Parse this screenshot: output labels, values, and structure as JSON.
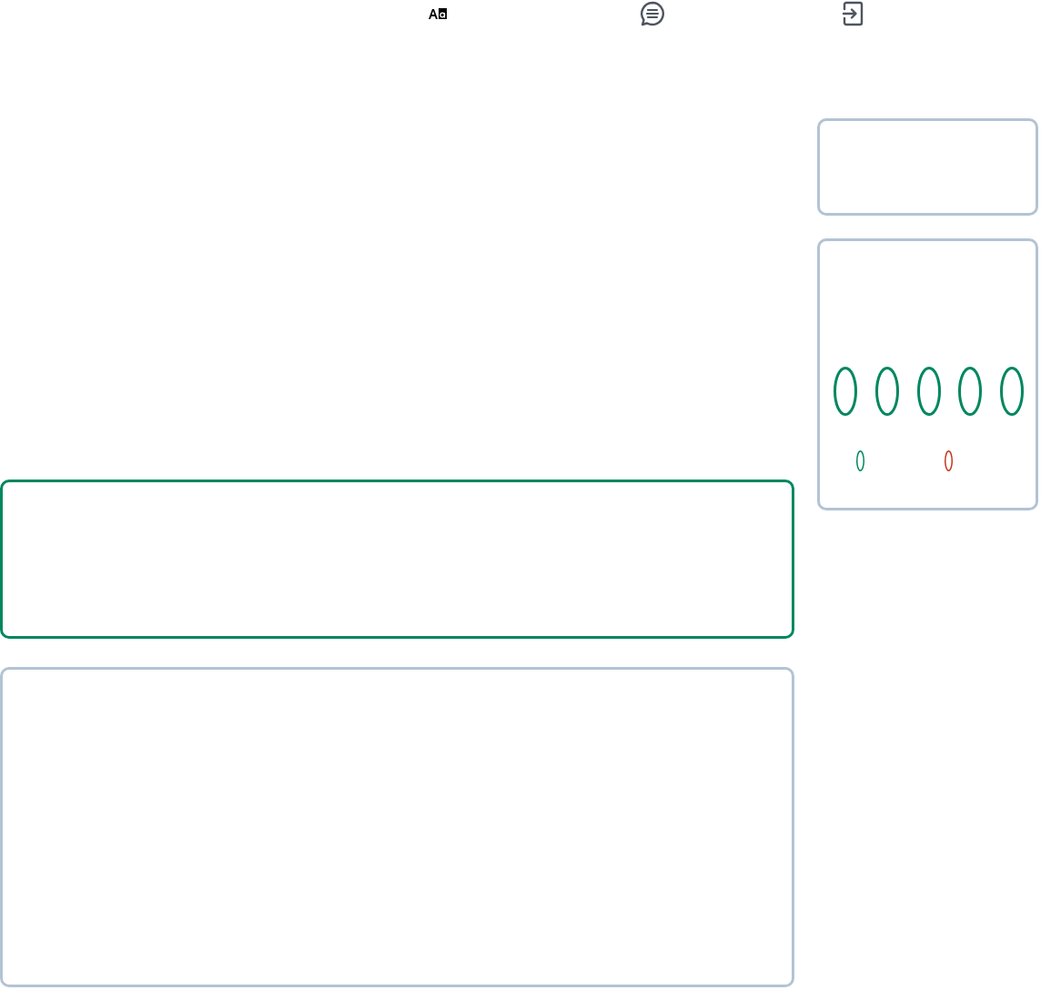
{
  "toolbar": [
    {
      "kind": "text-size"
    },
    {
      "kind": "chat"
    },
    {
      "kind": "login"
    }
  ],
  "main_panels": [
    {
      "selected": true
    },
    {
      "selected": false
    }
  ],
  "side_panels": [
    {
      "kind": "blank"
    },
    {
      "kind": "rings"
    }
  ],
  "rings": [
    {
      "kind": "large",
      "color": "#00875f"
    },
    {
      "kind": "large",
      "color": "#00875f"
    },
    {
      "kind": "large",
      "color": "#00875f"
    },
    {
      "kind": "large",
      "color": "#00875f"
    },
    {
      "kind": "large",
      "color": "#00875f"
    },
    {
      "kind": "small",
      "color": "#00875f"
    },
    {
      "kind": "small",
      "color": "#c0391b"
    }
  ]
}
